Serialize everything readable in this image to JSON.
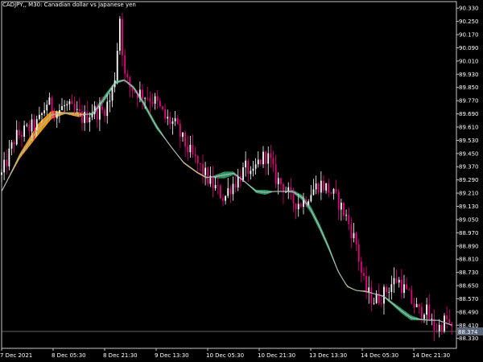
{
  "window": {
    "symbol_label": "CADJPY,, M30:  Canadian dollar vs Japanese yen"
  },
  "colors": {
    "background": "#000000",
    "frame": "#c8c8c8",
    "text": "#ffffff",
    "candle_up": "#ffffff",
    "candle_down": "#e6007e",
    "ribbon_up": "#2e9e6a",
    "ribbon_down": "#f5a21c",
    "ma_line": "#a9b8b0",
    "bid_line": "#c8c8c8",
    "price_tag_bg": "#5a6478"
  },
  "chart_data": {
    "type": "candlestick",
    "symbol": "CADJPY",
    "timeframe": "M30",
    "ylim": [
      88.27,
      90.37
    ],
    "y_ticks": [
      "90.330",
      "90.250",
      "90.170",
      "90.090",
      "90.010",
      "89.930",
      "89.850",
      "89.770",
      "89.690",
      "89.610",
      "89.530",
      "89.450",
      "89.370",
      "89.290",
      "89.210",
      "89.130",
      "89.050",
      "88.970",
      "88.890",
      "88.810",
      "88.730",
      "88.650",
      "88.570",
      "88.490",
      "88.410",
      "88.330"
    ],
    "current_price": "88.374",
    "x_ticks": [
      "7 Dec 2021",
      "8 Dec 05:30",
      "8 Dec 21:30",
      "9 Dec 13:30",
      "10 Dec 05:30",
      "10 Dec 21:30",
      "13 Dec 13:30",
      "14 Dec 05:30",
      "14 Dec 21:30"
    ],
    "price_path": [
      [
        0,
        89.32
      ],
      [
        3,
        89.55
      ],
      [
        6,
        89.6
      ],
      [
        8,
        89.63
      ],
      [
        10,
        89.76
      ],
      [
        12,
        89.7
      ],
      [
        14,
        89.74
      ],
      [
        16,
        89.7
      ],
      [
        18,
        89.66
      ],
      [
        20,
        89.71
      ],
      [
        22,
        89.7
      ],
      [
        24,
        89.78
      ],
      [
        25,
        89.94
      ],
      [
        26,
        90.28
      ],
      [
        27,
        89.92
      ],
      [
        28,
        89.86
      ],
      [
        30,
        89.82
      ],
      [
        32,
        89.8
      ],
      [
        34,
        89.76
      ],
      [
        36,
        89.66
      ],
      [
        38,
        89.63
      ],
      [
        40,
        89.52
      ],
      [
        42,
        89.43
      ],
      [
        44,
        89.35
      ],
      [
        46,
        89.27
      ],
      [
        48,
        89.21
      ],
      [
        49,
        89.18
      ],
      [
        50,
        89.24
      ],
      [
        52,
        89.3
      ],
      [
        54,
        89.37
      ],
      [
        55,
        89.28
      ],
      [
        56,
        89.38
      ],
      [
        58,
        89.44
      ],
      [
        59,
        89.41
      ],
      [
        60,
        89.31
      ],
      [
        62,
        89.25
      ],
      [
        64,
        89.16
      ],
      [
        66,
        89.15
      ],
      [
        68,
        89.22
      ],
      [
        70,
        89.27
      ],
      [
        71,
        89.25
      ],
      [
        72,
        89.23
      ],
      [
        74,
        89.16
      ],
      [
        76,
        89.05
      ],
      [
        78,
        88.9
      ],
      [
        79,
        88.74
      ],
      [
        80,
        88.62
      ],
      [
        82,
        88.56
      ],
      [
        84,
        88.6
      ],
      [
        86,
        88.67
      ],
      [
        87,
        88.69
      ],
      [
        88,
        88.65
      ],
      [
        90,
        88.56
      ],
      [
        92,
        88.48
      ],
      [
        93,
        88.52
      ],
      [
        94,
        88.45
      ],
      [
        95,
        88.4
      ],
      [
        96,
        88.39
      ],
      [
        97,
        88.43
      ],
      [
        98,
        88.44
      ],
      [
        99,
        88.37
      ]
    ],
    "ma_fast": [
      [
        0,
        89.22
      ],
      [
        4,
        89.42
      ],
      [
        8,
        89.56
      ],
      [
        11,
        89.66
      ],
      [
        14,
        89.69
      ],
      [
        17,
        89.67
      ],
      [
        20,
        89.7
      ],
      [
        22,
        89.78
      ],
      [
        25,
        89.89
      ],
      [
        27,
        89.9
      ],
      [
        29,
        89.86
      ],
      [
        31,
        89.78
      ],
      [
        34,
        89.63
      ],
      [
        37,
        89.5
      ],
      [
        40,
        89.39
      ],
      [
        43,
        89.33
      ],
      [
        45,
        89.3
      ],
      [
        47,
        89.32
      ],
      [
        49,
        89.34
      ],
      [
        51,
        89.34
      ],
      [
        53,
        89.29
      ],
      [
        56,
        89.23
      ],
      [
        58,
        89.23
      ],
      [
        60,
        89.22
      ],
      [
        62,
        89.22
      ],
      [
        64,
        89.23
      ],
      [
        66,
        89.2
      ],
      [
        68,
        89.13
      ],
      [
        70,
        89.02
      ],
      [
        72,
        88.89
      ],
      [
        74,
        88.74
      ],
      [
        76,
        88.64
      ],
      [
        78,
        88.62
      ],
      [
        80,
        88.61
      ],
      [
        82,
        88.6
      ],
      [
        84,
        88.59
      ],
      [
        86,
        88.55
      ],
      [
        88,
        88.51
      ],
      [
        90,
        88.47
      ],
      [
        92,
        88.45
      ],
      [
        94,
        88.44
      ],
      [
        96,
        88.44
      ],
      [
        98,
        88.42
      ],
      [
        99,
        88.41
      ]
    ],
    "ma_slow": [
      [
        0,
        89.22
      ],
      [
        4,
        89.45
      ],
      [
        8,
        89.63
      ],
      [
        11,
        89.71
      ],
      [
        14,
        89.7
      ],
      [
        17,
        89.7
      ],
      [
        20,
        89.68
      ],
      [
        22,
        89.74
      ],
      [
        25,
        89.87
      ],
      [
        27,
        89.89
      ],
      [
        29,
        89.84
      ],
      [
        31,
        89.75
      ],
      [
        34,
        89.6
      ],
      [
        37,
        89.5
      ],
      [
        40,
        89.4
      ],
      [
        43,
        89.34
      ],
      [
        45,
        89.31
      ],
      [
        47,
        89.3
      ],
      [
        49,
        89.3
      ],
      [
        51,
        89.32
      ],
      [
        53,
        89.29
      ],
      [
        56,
        89.21
      ],
      [
        58,
        89.2
      ],
      [
        60,
        89.22
      ],
      [
        62,
        89.22
      ],
      [
        64,
        89.21
      ],
      [
        66,
        89.17
      ],
      [
        68,
        89.09
      ],
      [
        70,
        88.98
      ],
      [
        72,
        88.86
      ],
      [
        74,
        88.73
      ],
      [
        76,
        88.65
      ],
      [
        78,
        88.62
      ],
      [
        80,
        88.62
      ],
      [
        82,
        88.6
      ],
      [
        84,
        88.58
      ],
      [
        86,
        88.53
      ],
      [
        88,
        88.48
      ],
      [
        90,
        88.44
      ],
      [
        92,
        88.44
      ],
      [
        94,
        88.44
      ],
      [
        96,
        88.44
      ],
      [
        98,
        88.42
      ],
      [
        99,
        88.41
      ]
    ],
    "candles_count": 180,
    "candle_seed": 12345
  }
}
